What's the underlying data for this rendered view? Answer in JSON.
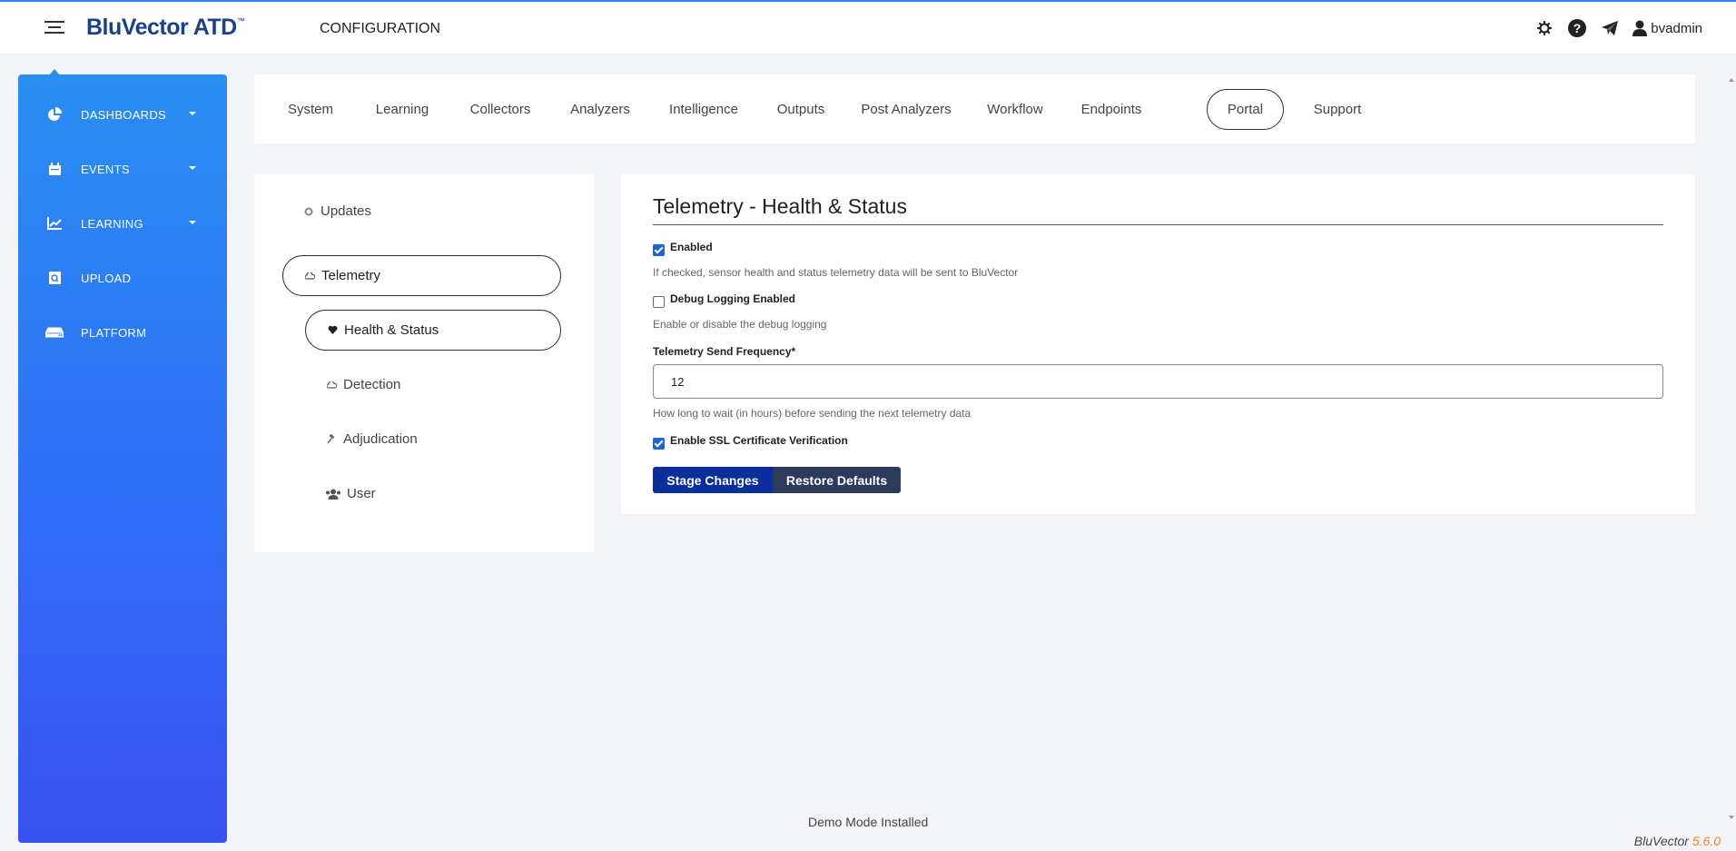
{
  "header": {
    "logo_main": "BluVector ATD",
    "logo_tm": "™",
    "page_title": "CONFIGURATION",
    "username": "bvadmin"
  },
  "sidebar": {
    "items": [
      {
        "label": "DASHBOARDS",
        "icon": "pie-chart-icon"
      },
      {
        "label": "EVENTS",
        "icon": "calendar-icon"
      },
      {
        "label": "LEARNING",
        "icon": "line-chart-icon"
      },
      {
        "label": "UPLOAD",
        "icon": "upload-file-icon"
      },
      {
        "label": "PLATFORM",
        "icon": "server-icon"
      }
    ]
  },
  "tabs": {
    "items": [
      "System",
      "Learning",
      "Collectors",
      "Analyzers",
      "Intelligence",
      "Outputs",
      "Post Analyzers",
      "Workflow",
      "Endpoints",
      "Portal",
      "Support"
    ],
    "active": "Portal"
  },
  "side_menu": {
    "updates": "Updates",
    "telemetry": "Telemetry",
    "health_status": "Health & Status",
    "detection": "Detection",
    "adjudication": "Adjudication",
    "user": "User"
  },
  "form": {
    "title": "Telemetry - Health & Status",
    "enabled_label": "Enabled",
    "enabled_checked": true,
    "enabled_help": "If checked, sensor health and status telemetry data will be sent to BluVector",
    "debug_label": "Debug Logging Enabled",
    "debug_checked": false,
    "debug_help": "Enable or disable the debug logging",
    "frequency_label": "Telemetry Send Frequency*",
    "frequency_value": "12",
    "frequency_help": "How long to wait (in hours) before sending the next telemetry data",
    "ssl_label": "Enable SSL Certificate Verification",
    "ssl_checked": true,
    "stage_button": "Stage Changes",
    "restore_button": "Restore Defaults"
  },
  "footer": {
    "status": "Demo Mode Installed",
    "brand": "BluVector",
    "version": "5.6.0"
  },
  "colors": {
    "accent": "#2b86f0",
    "sidebar_top": "#2a8ef2",
    "sidebar_bottom": "#3a52f0",
    "primary_button": "#0a2e9c",
    "secondary_button": "#2c3b5c",
    "version": "#e8852a"
  }
}
